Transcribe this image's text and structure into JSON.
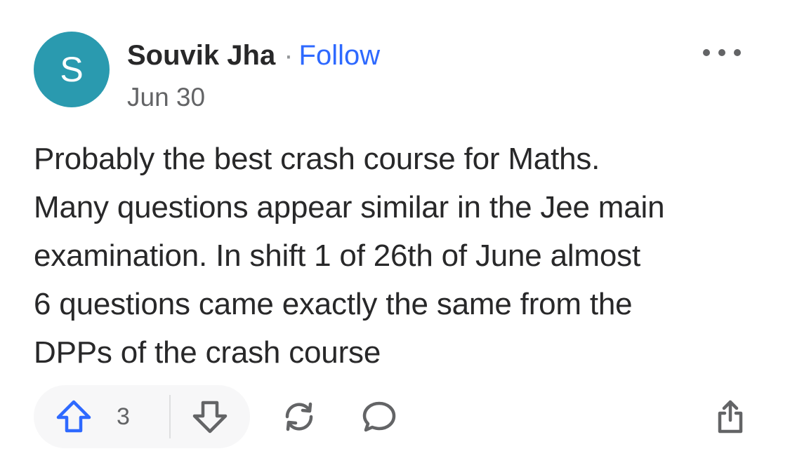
{
  "author": {
    "avatar_letter": "S",
    "avatar_color": "#2a9aaf",
    "name": "Souvik Jha",
    "separator": "·",
    "follow_label": "Follow",
    "date": "Jun 30"
  },
  "post": {
    "body": "Probably the best crash course for Maths.\nMany questions appear similar in the Jee main\nexamination. In shift 1 of 26th of June almost\n6 questions came exactly the same from the\nDPPs of the crash course"
  },
  "actions": {
    "upvote_count": "3",
    "upvote_icon": "arrow-up-outline-icon",
    "downvote_icon": "arrow-down-outline-icon",
    "share_icon": "reshare-cycle-icon",
    "comment_icon": "speech-bubble-icon",
    "export_icon": "share-upload-icon",
    "more_icon": "three-dots-icon"
  },
  "colors": {
    "accent": "#2e69ff",
    "text": "#282829",
    "muted": "#636466"
  }
}
